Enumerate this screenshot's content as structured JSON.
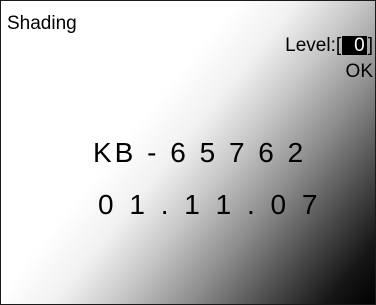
{
  "title": "Shading",
  "level": {
    "label": "Level:",
    "open_bracket": "[",
    "value": "0",
    "close_bracket": "]"
  },
  "status": "OK",
  "display": {
    "line1": "KB - 6 5 7 6 2",
    "line2": "0 1 . 1 1 . 0 7"
  },
  "colors": {
    "shading_light": "#ffffff",
    "shading_dark": "#000000",
    "text": "#000000",
    "level_box_bg": "#000000",
    "level_box_text": "#ffffff"
  }
}
